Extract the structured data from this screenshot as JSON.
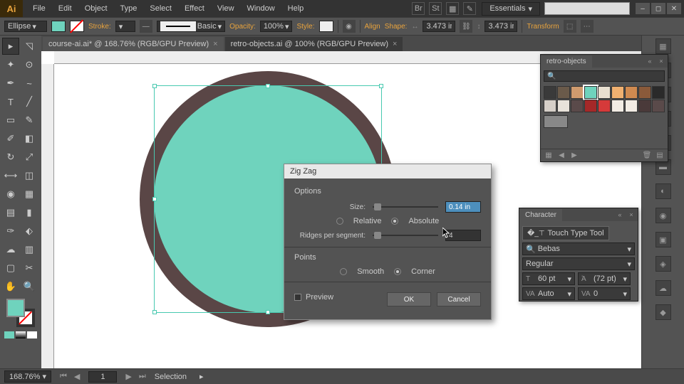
{
  "app": {
    "logo": "Ai"
  },
  "menu": [
    "File",
    "Edit",
    "Object",
    "Type",
    "Select",
    "Effect",
    "View",
    "Window",
    "Help"
  ],
  "workspace_dd": "Essentials",
  "controlbar": {
    "tool": "Ellipse",
    "stroke_label": "Stroke:",
    "basic_label": "Basic",
    "opacity_label": "Opacity:",
    "opacity_value": "100%",
    "style_label": "Style:",
    "align_label": "Align",
    "shape_label": "Shape:",
    "w_value": "3.473 in",
    "h_value": "3.473 in",
    "transform_label": "Transform"
  },
  "tabs": [
    {
      "label": "course-ai.ai* @ 168.76% (RGB/GPU Preview)",
      "active": true
    },
    {
      "label": "retro-objects.ai @ 100% (RGB/GPU Preview)",
      "active": false
    }
  ],
  "dialog": {
    "title": "Zig Zag",
    "options_label": "Options",
    "size_label": "Size:",
    "size_value": "0.14 in",
    "relative_label": "Relative",
    "absolute_label": "Absolute",
    "ridges_label": "Ridges per segment:",
    "ridges_value": "4",
    "points_label": "Points",
    "smooth_label": "Smooth",
    "corner_label": "Corner",
    "preview_label": "Preview",
    "ok": "OK",
    "cancel": "Cancel"
  },
  "swatch_panel": {
    "title": "retro-objects",
    "colors_row1": [
      "#3a3a3a",
      "#6a5a4a",
      "#cf9b6e",
      "#6fd3bd",
      "#e8e0d0",
      "#f0b070",
      "#d08a50",
      "#8a5a3a"
    ],
    "colors_row2": [
      "#2a2a2a",
      "#d6cfc8",
      "#e8e2da",
      "#5a4a4a",
      "#a52828",
      "#d63a3a",
      "#f2ece4",
      "#f2ece4"
    ],
    "colors_row3": [
      "#4a3a3a",
      "#5a4a4a"
    ]
  },
  "char_panel": {
    "title": "Character",
    "touch_type": "Touch Type Tool",
    "font": "Bebas",
    "style": "Regular",
    "size": "60 pt",
    "leading": "(72 pt)",
    "kerning": "Auto",
    "tracking": "0"
  },
  "status": {
    "zoom": "168.76%",
    "nav": "1",
    "tool": "Selection"
  }
}
